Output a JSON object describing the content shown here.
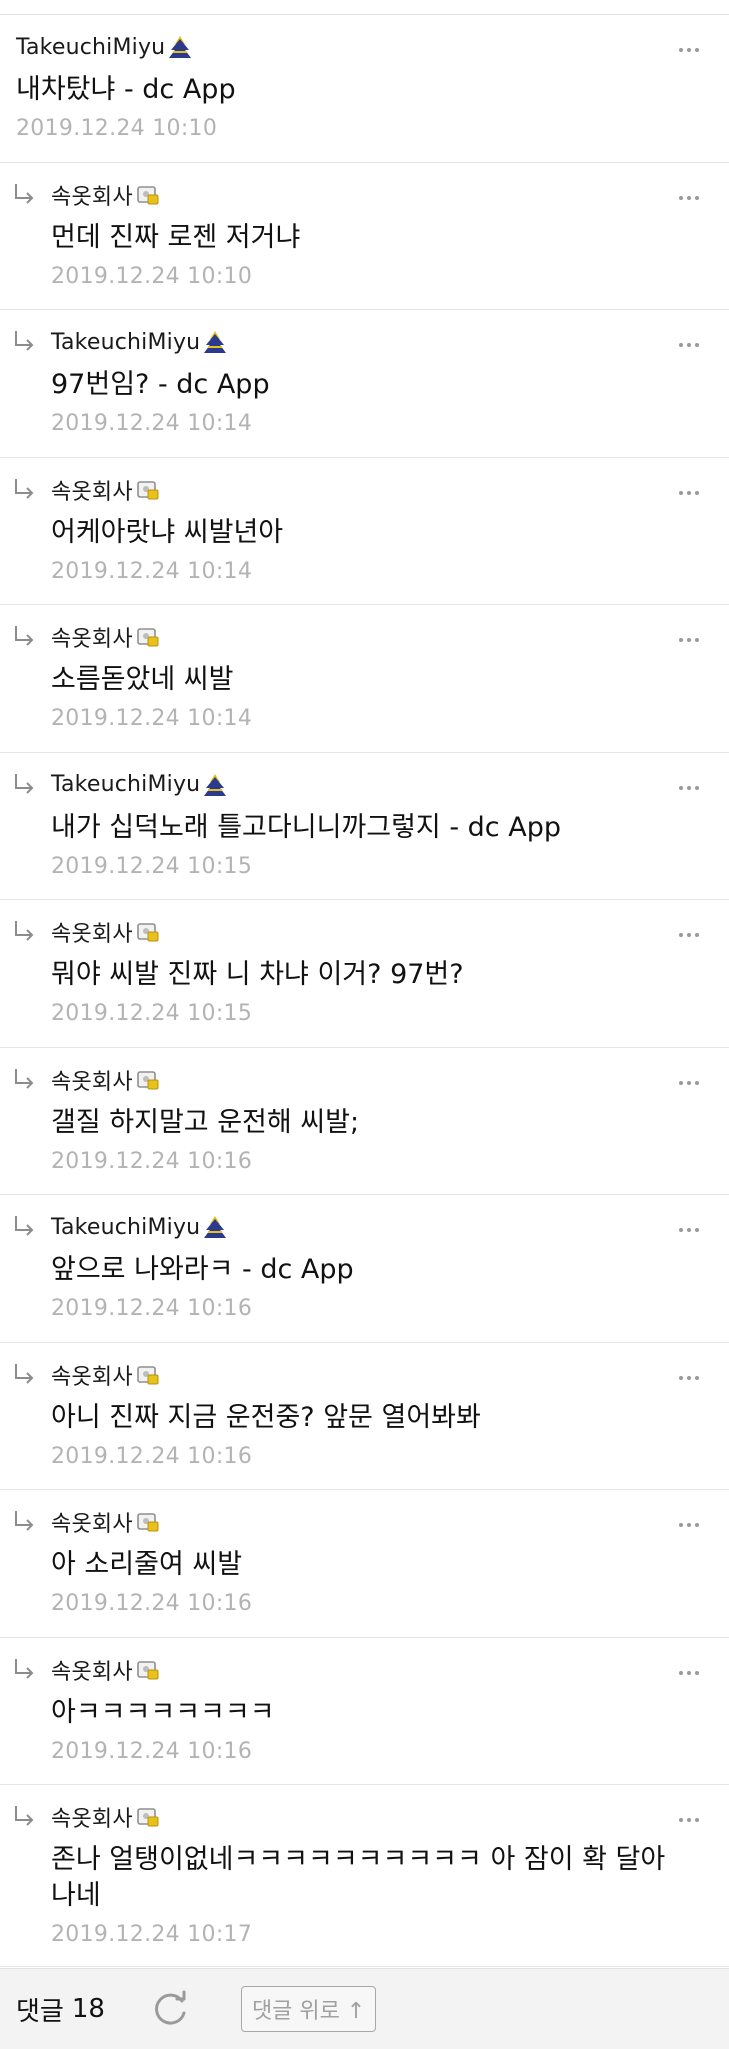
{
  "comments": [
    {
      "author": "TakeuchiMiyu",
      "badge": "gall-badge",
      "reply": false,
      "text": "내차탔냐  - dc App",
      "time": "2019.12.24 10:10"
    },
    {
      "author": "속옷회사",
      "badge": "fixed-nick-badge",
      "reply": true,
      "text": "먼데 진짜 로젠 저거냐",
      "time": "2019.12.24 10:10"
    },
    {
      "author": "TakeuchiMiyu",
      "badge": "gall-badge",
      "reply": true,
      "text": "97번임?  - dc App",
      "time": "2019.12.24 10:14"
    },
    {
      "author": "속옷회사",
      "badge": "fixed-nick-badge",
      "reply": true,
      "text": "어케아랏냐 씨발년아",
      "time": "2019.12.24 10:14"
    },
    {
      "author": "속옷회사",
      "badge": "fixed-nick-badge",
      "reply": true,
      "text": "소름돋았네 씨발",
      "time": "2019.12.24 10:14"
    },
    {
      "author": "TakeuchiMiyu",
      "badge": "gall-badge",
      "reply": true,
      "text": "내가 십덕노래 틀고다니니까그렇지  - dc App",
      "time": "2019.12.24 10:15"
    },
    {
      "author": "속옷회사",
      "badge": "fixed-nick-badge",
      "reply": true,
      "text": "뭐야 씨발 진짜 니 차냐 이거? 97번?",
      "time": "2019.12.24 10:15"
    },
    {
      "author": "속옷회사",
      "badge": "fixed-nick-badge",
      "reply": true,
      "text": "갤질 하지말고 운전해 씨발;",
      "time": "2019.12.24 10:16"
    },
    {
      "author": "TakeuchiMiyu",
      "badge": "gall-badge",
      "reply": true,
      "text": "앞으로 나와라ㅋ  - dc App",
      "time": "2019.12.24 10:16"
    },
    {
      "author": "속옷회사",
      "badge": "fixed-nick-badge",
      "reply": true,
      "text": "아니 진짜 지금 운전중? 앞문 열어봐봐",
      "time": "2019.12.24 10:16"
    },
    {
      "author": "속옷회사",
      "badge": "fixed-nick-badge",
      "reply": true,
      "text": "아 소리줄여 씨발",
      "time": "2019.12.24 10:16"
    },
    {
      "author": "속옷회사",
      "badge": "fixed-nick-badge",
      "reply": true,
      "text": "아ㅋㅋㅋㅋㅋㅋㅋㅋ",
      "time": "2019.12.24 10:16"
    },
    {
      "author": "속옷회사",
      "badge": "fixed-nick-badge",
      "reply": true,
      "text": "존나 얼탱이없네ㅋㅋㅋㅋㅋㅋㅋㅋㅋㅋ 아 잠이 확 달아나네",
      "time": "2019.12.24 10:17"
    }
  ],
  "icons": {
    "reply": "reply-arrow-icon",
    "more": "more-options-icon",
    "refresh": "refresh-icon"
  },
  "footer": {
    "count_label": "댓글",
    "count": "18",
    "to_top_label": "댓글 위로 ↑"
  },
  "colors": {
    "timestamp": "#b3b3b3",
    "divider": "#e6e6e6",
    "footer_bg": "#f3f3f3",
    "badge_navy": "#2b3a8c",
    "badge_gold": "#e8c21a"
  }
}
